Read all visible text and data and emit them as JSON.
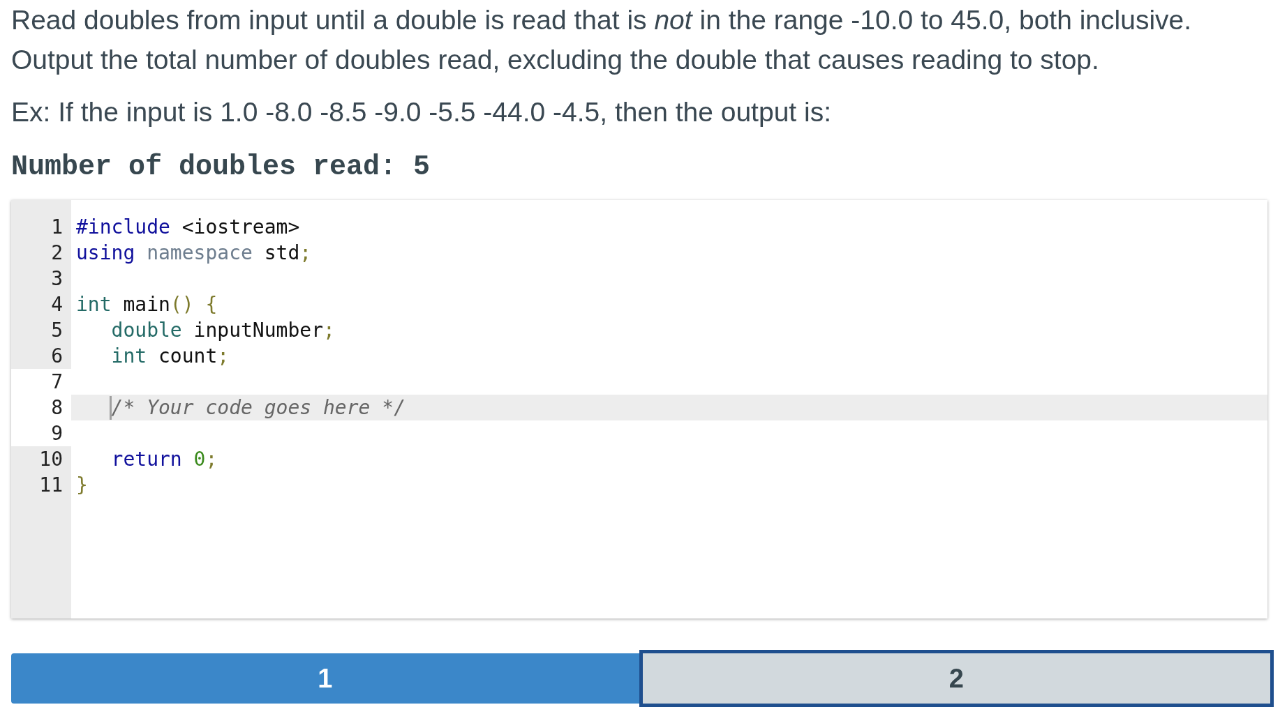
{
  "prompt": {
    "description": "Read doubles from input until a double is read that is *not* in the range -10.0 to 45.0, both inclusive. Output the total number of doubles read, excluding the double that causes reading to stop.",
    "example": "Ex: If the input is 1.0 -8.0 -8.5 -9.0 -5.5 -44.0 -4.5, then the output is:",
    "sample_output": "Number of doubles read: 5"
  },
  "editor": {
    "lines": [
      {
        "number": "1",
        "editable": false,
        "current": false,
        "tokens": [
          {
            "kind": "preprocessor",
            "text": "#include"
          },
          {
            "kind": "plain",
            "text": " <iostream>"
          }
        ]
      },
      {
        "number": "2",
        "editable": false,
        "current": false,
        "tokens": [
          {
            "kind": "keyword",
            "text": "using"
          },
          {
            "kind": "modifier",
            "text": " namespace"
          },
          {
            "kind": "plain",
            "text": " std"
          },
          {
            "kind": "punctuation",
            "text": ";"
          }
        ]
      },
      {
        "number": "3",
        "editable": false,
        "current": false
      },
      {
        "number": "4",
        "editable": false,
        "current": false,
        "tokens": [
          {
            "kind": "type",
            "text": "int"
          },
          {
            "kind": "plain",
            "text": " main"
          },
          {
            "kind": "punctuation",
            "text": "() {"
          }
        ],
        "children": [
          {
            "number": "5",
            "editable": false,
            "current": false,
            "tokens": [
              {
                "kind": "type",
                "text": "double"
              },
              {
                "kind": "plain",
                "text": " inputNumber"
              },
              {
                "kind": "punctuation",
                "text": ";"
              }
            ]
          },
          {
            "number": "6",
            "editable": false,
            "current": false,
            "tokens": [
              {
                "kind": "type",
                "text": "int"
              },
              {
                "kind": "plain",
                "text": " count"
              },
              {
                "kind": "punctuation",
                "text": ";"
              }
            ]
          },
          {
            "number": "7",
            "editable": true,
            "current": false
          },
          {
            "number": "8",
            "editable": true,
            "current": true,
            "tokens": [
              {
                "kind": "comment",
                "text": "/* Your code goes here */"
              }
            ]
          },
          {
            "number": "9",
            "editable": true,
            "current": false
          },
          {
            "number": "10",
            "editable": false,
            "current": false,
            "tokens": [
              {
                "kind": "keyword",
                "text": "return"
              },
              {
                "kind": "number",
                "text": " 0"
              },
              {
                "kind": "punctuation",
                "text": ";"
              }
            ]
          }
        ]
      },
      {
        "number": "11",
        "editable": false,
        "current": false,
        "tokens": [
          {
            "kind": "punctuation",
            "text": "}"
          }
        ]
      }
    ]
  },
  "levels": [
    {
      "label": "1",
      "completed": true,
      "selected": false
    },
    {
      "label": "2",
      "completed": false,
      "selected": true
    }
  ]
}
